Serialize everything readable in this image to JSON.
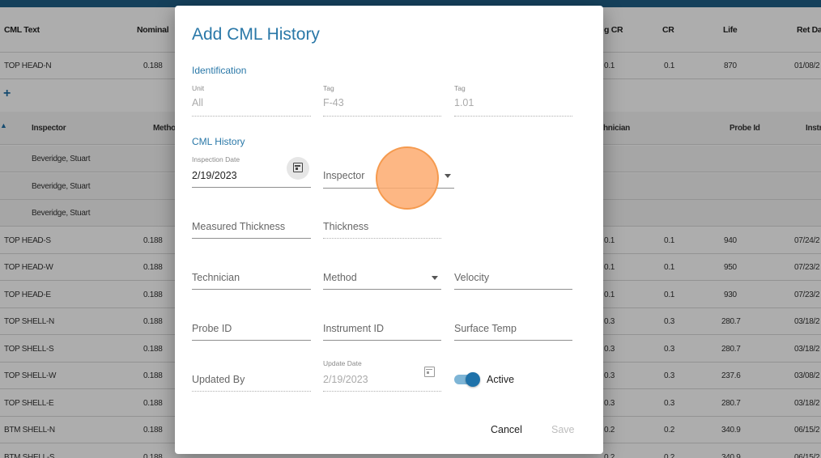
{
  "table": {
    "headers": {
      "cml_text": "CML Text",
      "nominal": "Nominal",
      "avg_cr": "g CR",
      "cr": "CR",
      "life": "Life",
      "ret_date": "Ret Dat"
    },
    "rows": [
      {
        "name": "TOP HEAD-N",
        "nominal": "0.188",
        "avg_cr": "0.1",
        "cr": "0.1",
        "life": "870",
        "ret": "01/08/2"
      },
      {
        "name": "TOP HEAD-S",
        "nominal": "0.188",
        "avg_cr": "0.1",
        "cr": "0.1",
        "life": "940",
        "ret": "07/24/2"
      },
      {
        "name": "TOP HEAD-W",
        "nominal": "0.188",
        "avg_cr": "0.1",
        "cr": "0.1",
        "life": "950",
        "ret": "07/23/2"
      },
      {
        "name": "TOP HEAD-E",
        "nominal": "0.188",
        "avg_cr": "0.1",
        "cr": "0.1",
        "life": "930",
        "ret": "07/23/2"
      },
      {
        "name": "TOP SHELL-N",
        "nominal": "0.188",
        "avg_cr": "0.3",
        "cr": "0.3",
        "life": "280.7",
        "ret": "03/18/2"
      },
      {
        "name": "TOP SHELL-S",
        "nominal": "0.188",
        "avg_cr": "0.3",
        "cr": "0.3",
        "life": "280.7",
        "ret": "03/18/2"
      },
      {
        "name": "TOP SHELL-W",
        "nominal": "0.188",
        "avg_cr": "0.3",
        "cr": "0.3",
        "life": "237.6",
        "ret": "03/08/2"
      },
      {
        "name": "TOP SHELL-E",
        "nominal": "0.188",
        "avg_cr": "0.3",
        "cr": "0.3",
        "life": "280.7",
        "ret": "03/18/2"
      },
      {
        "name": "BTM SHELL-N",
        "nominal": "0.188",
        "avg_cr": "0.2",
        "cr": "0.2",
        "life": "340.9",
        "ret": "06/15/2"
      },
      {
        "name": "BTM SHELL-S",
        "nominal": "0.188",
        "avg_cr": "0.2",
        "cr": "0.2",
        "life": "340.9",
        "ret": "06/15/2"
      }
    ],
    "sub_headers": {
      "inspector": "Inspector",
      "method": "Metho",
      "technician": "hnician",
      "probe_id": "Probe Id",
      "instrument": "Instr"
    },
    "sub_rows": [
      "Beveridge, Stuart",
      "Beveridge, Stuart",
      "Beveridge, Stuart"
    ],
    "add_icon": "+"
  },
  "dialog": {
    "title": "Add CML History",
    "identification": {
      "heading": "Identification",
      "unit_label": "Unit",
      "unit_value": "All",
      "tag_label": "Tag",
      "tag_value": "F-43",
      "tag2_label": "Tag",
      "tag2_value": "1.01"
    },
    "history": {
      "heading": "CML History",
      "inspection_date_label": "Inspection Date",
      "inspection_date_value": "2/19/2023",
      "inspector": "Inspector",
      "measured_thickness": "Measured Thickness",
      "thickness": "Thickness",
      "technician": "Technician",
      "method": "Method",
      "velocity": "Velocity",
      "probe_id": "Probe ID",
      "instrument_id": "Instrument ID",
      "surface_temp": "Surface Temp",
      "updated_by": "Updated By",
      "update_date_label": "Update Date",
      "update_date_value": "2/19/2023",
      "active_label": "Active",
      "active": true
    },
    "buttons": {
      "cancel": "Cancel",
      "save": "Save"
    }
  },
  "colors": {
    "accent": "#2a78a8",
    "topbar": "#1f5f86",
    "cursor": "#f59a4e"
  }
}
